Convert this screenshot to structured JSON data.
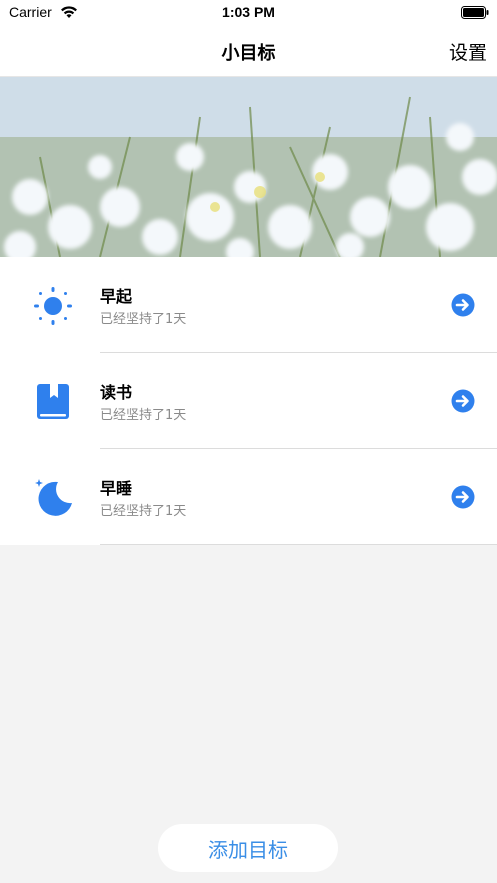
{
  "status_bar": {
    "carrier": "Carrier",
    "time": "1:03 PM"
  },
  "nav": {
    "title": "小目标",
    "settings_label": "设置"
  },
  "hero": {
    "image": "frosted-grass-photo"
  },
  "goals": [
    {
      "icon": "sun-icon",
      "name": "早起",
      "streak": "已经坚持了1天"
    },
    {
      "icon": "book-icon",
      "name": "读书",
      "streak": "已经坚持了1天"
    },
    {
      "icon": "moon-icon",
      "name": "早睡",
      "streak": "已经坚持了1天"
    }
  ],
  "add_button_label": "添加目标",
  "colors": {
    "accent": "#3a8ee6",
    "icon_blue": "#2f80ed",
    "background": "#f3f3f3"
  }
}
